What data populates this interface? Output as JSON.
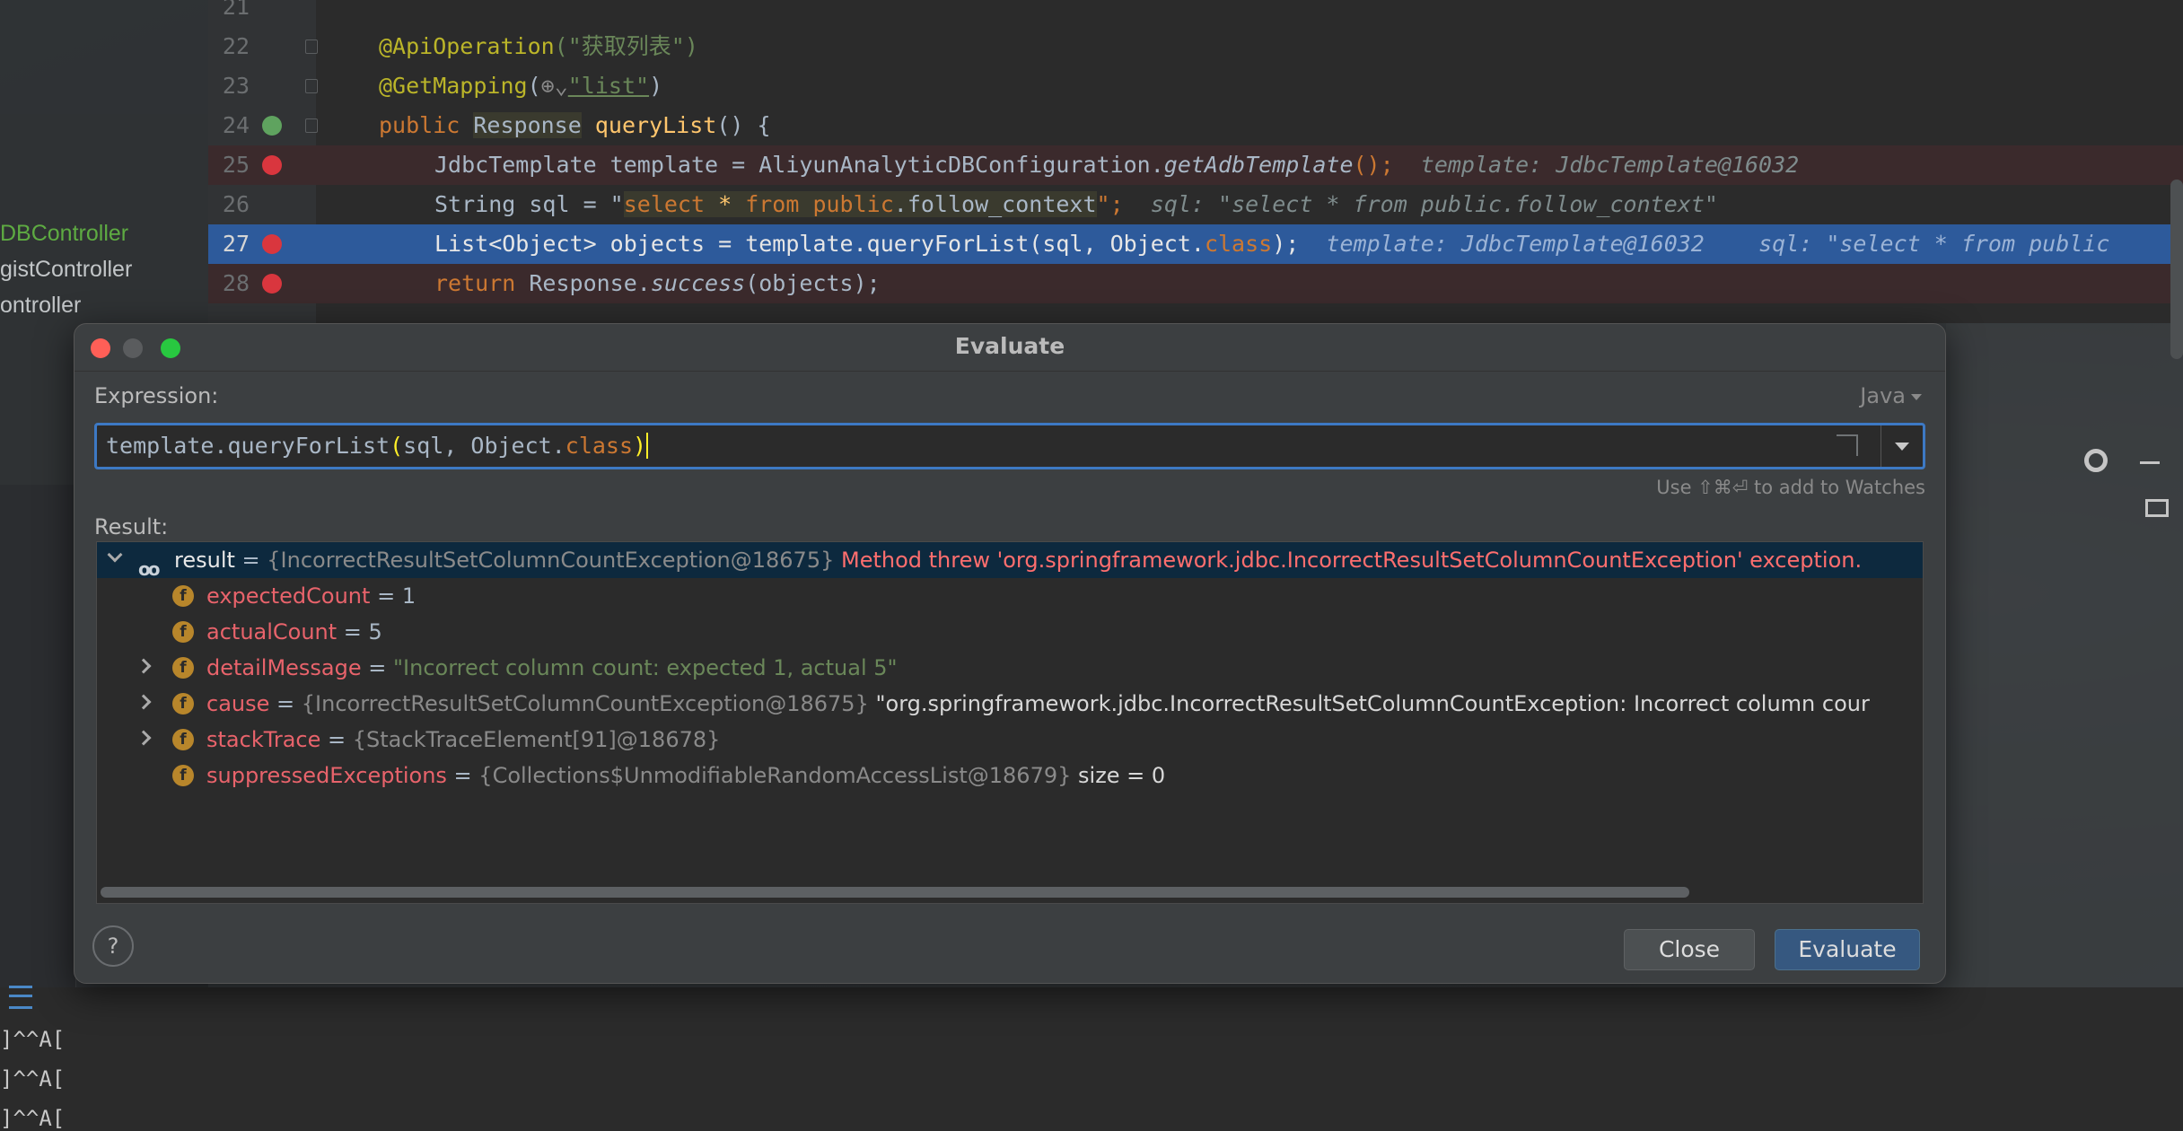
{
  "project": {
    "items": [
      "DBController",
      "gistController",
      "ontroller"
    ]
  },
  "console": {
    "lines": [
      "]^^A[",
      "]^^A[",
      "]^^A["
    ]
  },
  "editor": {
    "lines": [
      {
        "num": "21"
      },
      {
        "num": "22"
      },
      {
        "num": "23"
      },
      {
        "num": "24"
      },
      {
        "num": "25",
        "hint": "template: JdbcTemplate@16032"
      },
      {
        "num": "26",
        "hint": "sql: \"select * from public.follow_context\""
      },
      {
        "num": "27",
        "hint": "template: JdbcTemplate@16032    sql: \"select * from public"
      },
      {
        "num": "28"
      }
    ],
    "tokens": {
      "api_op": "@ApiOperation",
      "api_op_arg": "(\"获取列表\")",
      "get_mapping": "@GetMapping",
      "get_mapping_icon": "⊕⌄",
      "get_mapping_arg": "\"list\"",
      "kw_public": "public",
      "type_response": "Response",
      "method_name": "queryList",
      "sig_rest": "() {",
      "l25_a": "JdbcTemplate template = AliyunAnalyticDBConfiguration.",
      "l25_b": "getAdbTemplate",
      "l25_c": "();",
      "l26_a": "String sql = \"",
      "l26_sql_kw1": "select",
      "l26_sql_star": " * ",
      "l26_sql_kw2": "from",
      "l26_sql_schema": " public",
      "l26_sql_rest": ".follow_context",
      "l26_end": "\";",
      "l27_a": "List<Object> objects = ",
      "l27_b": "template.queryForList(sql, Object.",
      "l27_class": "class",
      "l27_c": ");",
      "l28_kw": "return",
      "l28_a": " Response.",
      "l28_b": "success",
      "l28_c": "(objects);"
    }
  },
  "dialog": {
    "title": "Evaluate",
    "expression_label": "Expression:",
    "language": "Java",
    "expression_value_a": "template.queryForList",
    "expression_value_paren_open": "(",
    "expression_value_b": "sql, Object.",
    "expression_value_class": "class",
    "expression_value_paren_close": ")",
    "watch_hint": "Use ⇧⌘⏎ to add to Watches",
    "result_label": "Result:",
    "tree": [
      {
        "name": "result",
        "eq": " = ",
        "value": "{IncorrectResultSetColumnCountException@18675}",
        "extra": " Method threw 'org.springframework.jdbc.IncorrectResultSetColumnCountException' exception."
      },
      {
        "name": "expectedCount",
        "eq": " = ",
        "value": "1"
      },
      {
        "name": "actualCount",
        "eq": " = ",
        "value": "5"
      },
      {
        "name": "detailMessage",
        "eq": " = ",
        "value": "\"Incorrect column count: expected 1, actual 5\""
      },
      {
        "name": "cause",
        "eq": " = ",
        "value": "{IncorrectResultSetColumnCountException@18675}",
        "extra": " \"org.springframework.jdbc.IncorrectResultSetColumnCountException: Incorrect column cour"
      },
      {
        "name": "stackTrace",
        "eq": " = ",
        "value": "{StackTraceElement[91]@18678}"
      },
      {
        "name": "suppressedExceptions",
        "eq": " = ",
        "value": "{Collections$UnmodifiableRandomAccessList@18679}",
        "extra": "  size = 0"
      }
    ],
    "field_icon": "f",
    "help_label": "?",
    "close_label": "Close",
    "evaluate_label": "Evaluate"
  }
}
